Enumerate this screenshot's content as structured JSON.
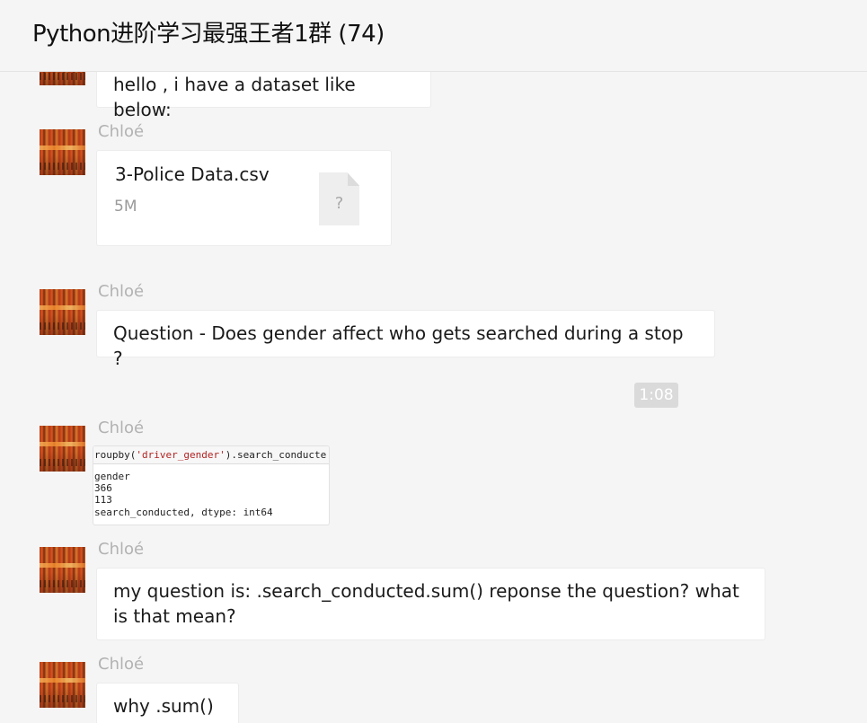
{
  "header": {
    "title": "Python进阶学习最强王者1群 (74)"
  },
  "messages": [
    {
      "text": "hello , i have a dataset like below:"
    },
    {
      "sender": "Chloé",
      "file": {
        "name": "3-Police Data.csv",
        "size": "5M",
        "icon_glyph": "?"
      }
    },
    {
      "sender": "Chloé",
      "text": "Question - Does gender affect who gets searched during a stop ?"
    },
    {
      "timestamp": "1:08"
    },
    {
      "sender": "Chloé",
      "image": {
        "code_prefix": "roupby(",
        "code_string": "'driver_gender'",
        "code_suffix": ").search_conducte",
        "output_lines": [
          " gender",
          "366",
          "113",
          "search_conducted, dtype: int64"
        ]
      }
    },
    {
      "sender": "Chloé",
      "text_line1": "my question is:  .search_conducted.sum()  reponse the question? what",
      "text_line2": "is that mean?"
    },
    {
      "sender": "Chloé",
      "text": "why .sum() ?"
    }
  ],
  "colors": {
    "background": "#f5f5f5",
    "bubble": "#ffffff",
    "sender_name": "#b2b2b2",
    "timestamp_chip": "#dadada"
  },
  "icons": {
    "file": "generic-file-icon"
  }
}
